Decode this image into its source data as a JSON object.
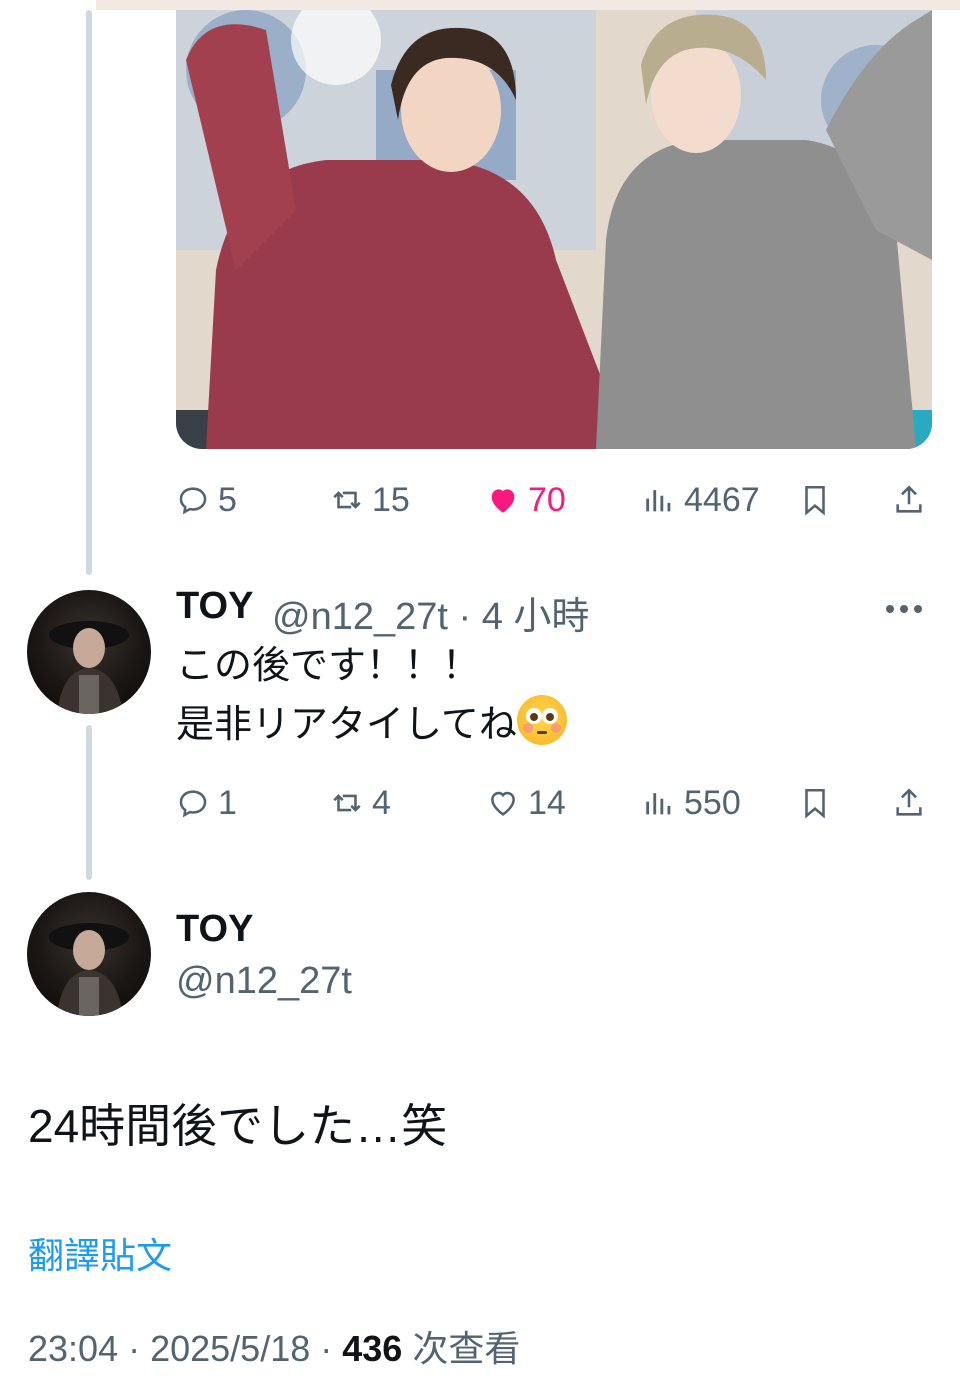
{
  "colors": {
    "text_primary": "#0f1419",
    "text_secondary": "#536471",
    "like_active": "#f91880",
    "link_blue": "#1d9bf0",
    "thread_line": "#cfd9de"
  },
  "first_tweet": {
    "photo": {
      "icon": "photo-two-people-hoodies"
    },
    "actions": {
      "replies": "5",
      "retweets": "15",
      "likes": "70",
      "views": "4467",
      "liked": true
    }
  },
  "reply_tweet": {
    "name": "TOY",
    "handle_time": "@n12_27t · 4 小時",
    "lines": [
      "この後です！！！",
      "是非リアタイしてね"
    ],
    "emoji": "flushed-face-emoji",
    "actions": {
      "replies": "1",
      "retweets": "4",
      "likes": "14",
      "views": "550"
    }
  },
  "main_tweet": {
    "name": "TOY",
    "handle": "@n12_27t",
    "text": "24時間後でした…笑",
    "translate_label": "翻譯貼文",
    "time_date": "23:04 · 2025/5/18 · ",
    "view_count": "436",
    "view_label": " 次查看"
  }
}
